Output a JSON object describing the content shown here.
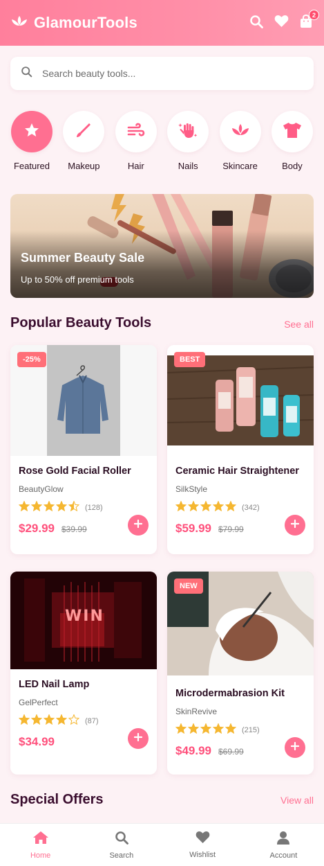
{
  "header": {
    "app_name": "GlamourTools",
    "cart_count": "2"
  },
  "search": {
    "placeholder": "Search beauty tools..."
  },
  "categories": [
    {
      "label": "Featured",
      "icon": "star-icon",
      "active": true
    },
    {
      "label": "Makeup",
      "icon": "makeup-brush-icon"
    },
    {
      "label": "Hair",
      "icon": "wind-icon"
    },
    {
      "label": "Nails",
      "icon": "hand-sparkles-icon"
    },
    {
      "label": "Skincare",
      "icon": "spa-icon"
    },
    {
      "label": "Body",
      "icon": "shirt-icon"
    }
  ],
  "banner": {
    "title": "Summer Beauty Sale",
    "subtitle": "Up to 50% off premium tools"
  },
  "popular": {
    "title": "Popular Beauty Tools",
    "link": "See all",
    "products": [
      {
        "tag": "-25%",
        "name": "Rose Gold Facial Roller",
        "brand": "BeautyGlow",
        "rating": 4.5,
        "reviews": "(128)",
        "price": "$29.99",
        "old_price": "$39.99"
      },
      {
        "tag": "BEST",
        "name": "Ceramic Hair Straightener",
        "brand": "SilkStyle",
        "rating": 5,
        "reviews": "(342)",
        "price": "$59.99",
        "old_price": "$79.99"
      },
      {
        "tag": "",
        "name": "LED Nail Lamp",
        "brand": "GelPerfect",
        "rating": 4,
        "reviews": "(87)",
        "price": "$34.99",
        "old_price": ""
      },
      {
        "tag": "NEW",
        "name": "Microdermabrasion Kit",
        "brand": "SkinRevive",
        "rating": 5,
        "reviews": "(215)",
        "price": "$49.99",
        "old_price": "$69.99"
      }
    ],
    "image_texts": {
      "neon_sign": "WIN"
    }
  },
  "special": {
    "title": "Special Offers",
    "link": "View all"
  },
  "nav": [
    {
      "label": "Home",
      "icon": "home-icon",
      "active": true
    },
    {
      "label": "Search",
      "icon": "search-icon"
    },
    {
      "label": "Wishlist",
      "icon": "heart-icon"
    },
    {
      "label": "Account",
      "icon": "user-icon"
    }
  ],
  "colors": {
    "brand": "#ff6f91",
    "price": "#ff4f7b",
    "tag": "#ff6f78",
    "star": "#f5b731",
    "title": "#3a0d2e"
  }
}
